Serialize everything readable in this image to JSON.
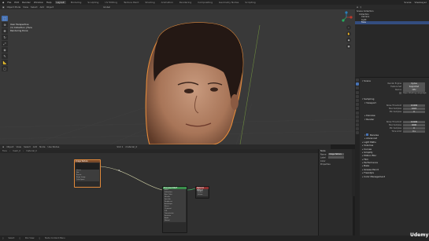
{
  "topbar": {
    "menus": [
      "File",
      "Edit",
      "Render",
      "Window",
      "Help"
    ],
    "workspaces": [
      "Layout",
      "Modeling",
      "Sculpting",
      "UV Editing",
      "Texture Paint",
      "Shading",
      "Animation",
      "Rendering",
      "Compositing",
      "Geometry Nodes",
      "Scripting"
    ],
    "active_workspace_index": 0,
    "scene_label": "Scene",
    "view_layer_label": "ViewLayer"
  },
  "viewport_header": {
    "mode": "Object Mode",
    "menus": [
      "View",
      "Select",
      "Add",
      "Object"
    ],
    "transform": "Global"
  },
  "viewport_info": {
    "line1": "User Perspective",
    "line2": "(1) Collection | Face",
    "line3": "Rendering Done"
  },
  "node_editor_header": {
    "type": "Object",
    "menus": [
      "View",
      "Select",
      "Add",
      "Node"
    ],
    "use_nodes": "Use Nodes",
    "slot": "Slot 1",
    "material": "material_0"
  },
  "node_editor_sub": {
    "items": [
      "Face",
      "mesh_0",
      "material_0"
    ]
  },
  "nodes": [
    {
      "title": "Image Texture",
      "rows": [
        "",
        "Linear",
        "Flat",
        "Repeat",
        "Single Image",
        "Color Space",
        "Alpha"
      ]
    },
    {
      "title": "Principled BSDF",
      "rows": [
        "BSDF",
        "Subsurface",
        "Base Color",
        "Metallic",
        "Specular",
        "Roughness",
        "Anisotropic",
        "Sheen",
        "Clearcoat",
        "IOR",
        "Transmission",
        "Emission",
        "Alpha",
        "Normal"
      ]
    },
    {
      "title": "Material Output",
      "rows": [
        "All",
        "Surface",
        "Volume",
        "Displacement"
      ]
    }
  ],
  "npanel": {
    "section": "Node",
    "name_label": "Name",
    "name_value": "Image Texture",
    "label_label": "Label",
    "color_label": "Color",
    "properties_label": "Properties"
  },
  "outliner": {
    "header": "Scene Collection",
    "items": [
      "Scene Collection",
      "Collection",
      "Camera",
      "Light",
      "Face"
    ],
    "selected_index": 4
  },
  "properties": {
    "sections": [
      {
        "label": "Scene",
        "open": true
      },
      {
        "label": "Sampling",
        "open": true
      },
      {
        "label": "Viewport",
        "open": true
      },
      {
        "label": "Render",
        "open": true
      },
      {
        "label": "Advanced",
        "open": false
      },
      {
        "label": "Light Paths",
        "open": false
      },
      {
        "label": "Volumes",
        "open": false
      },
      {
        "label": "Curves",
        "open": false
      },
      {
        "label": "Simplify",
        "open": false
      },
      {
        "label": "Motion Blur",
        "open": false
      },
      {
        "label": "Film",
        "open": false
      },
      {
        "label": "Performance",
        "open": false
      },
      {
        "label": "Bake",
        "open": false
      },
      {
        "label": "Grease Pencil",
        "open": false
      },
      {
        "label": "Freestyle",
        "open": false
      },
      {
        "label": "Color Management",
        "open": false
      }
    ],
    "render_engine_label": "Render Engine",
    "render_engine": "Cycles",
    "feature_set_label": "Feature Set",
    "feature_set": "Supported",
    "device_label": "Device",
    "device": "CPU",
    "open_shading_label": "Open Shading Language",
    "noise_threshold_label": "Noise Threshold",
    "noise_threshold": "0.1000",
    "max_samples_label": "Max Samples",
    "max_samples": "1024",
    "min_samples_label": "Min Samples",
    "min_samples": "0",
    "denoise_label": "Denoise",
    "render_noise_threshold": "0.0100",
    "render_max_samples": "4096",
    "render_min_samples": "0",
    "time_limit_label": "Time Limit",
    "time_limit": "0 s",
    "denoise_checked": true
  },
  "statusbar": {
    "items": [
      "Select",
      "Pan View",
      "Node Context Menu"
    ]
  },
  "brand": "Udemy",
  "colors": {
    "accent": "#4772b3",
    "selection_outline": "#e28a3b",
    "node_header_texture": "#7a4a2a",
    "node_header_shader": "#3a8f4c",
    "node_header_output": "#8c2f2f"
  }
}
